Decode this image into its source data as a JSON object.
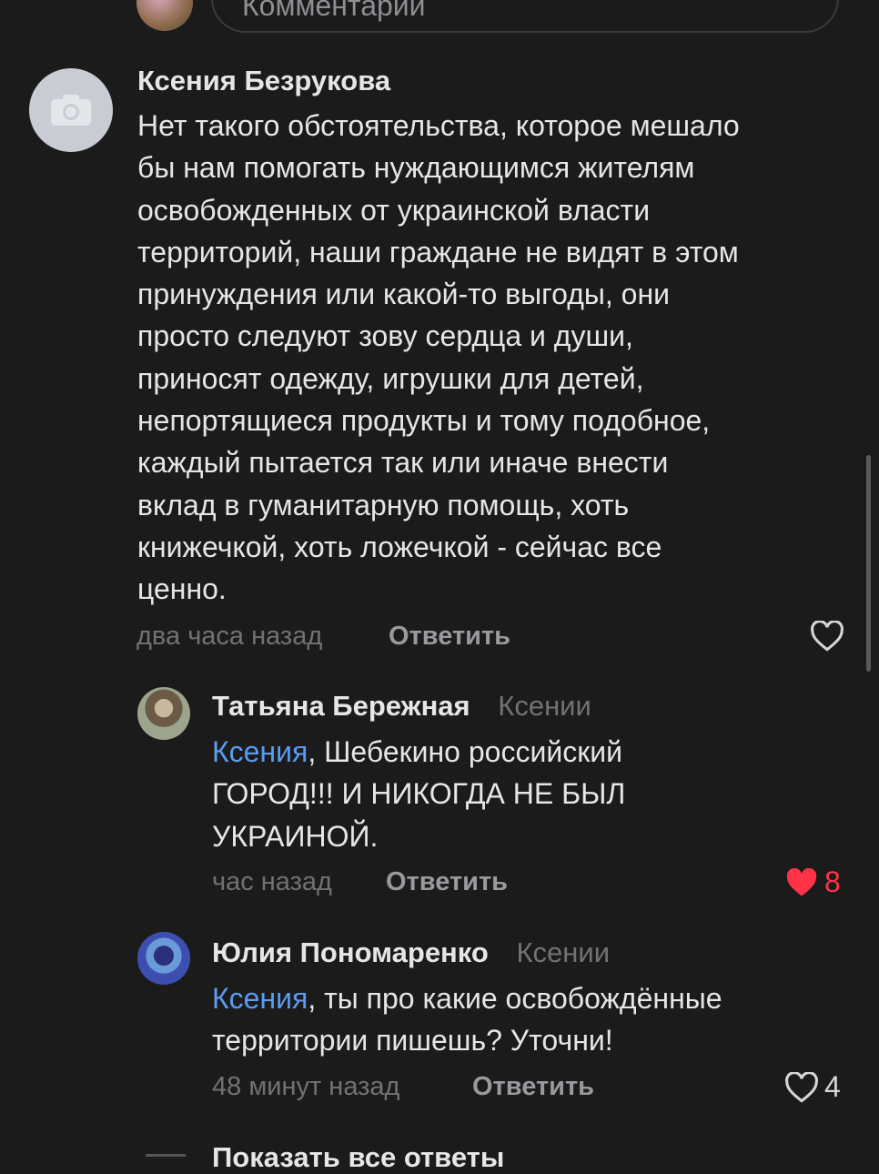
{
  "input": {
    "placeholder": "Комментарий"
  },
  "comment": {
    "author": "Ксения Безрукова",
    "text": "Нет такого обстоятельства, которое мешало бы нам помогать нуждающимся жителям освобожденных от украинской власти территорий, наши граждане не видят в этом принуждения или какой-то выгоды, они просто следуют зову сердца и души, приносят одежду, игрушки для детей, непортящиеся продукты и тому подобное, каждый пытается так или иначе внести вклад в гуманитарную помощь, хоть книжечкой, хоть ложечкой - сейчас все ценно.",
    "lines": [
      "Нет такого обстоятельства, которое мешало",
      "бы нам помогать нуждающимся жителям",
      "освобожденных от украинской власти",
      "территорий, наши граждане не видят в этом",
      "принуждения или какой-то выгоды, они",
      "просто следуют зову сердца и души,",
      "приносят одежду, игрушки для детей,",
      "непортящиеся продукты и тому подобное,",
      "каждый пытается так или иначе внести",
      "вклад в гуманитарную помощь, хоть",
      "книжечкой, хоть ложечкой - сейчас все",
      "ценно."
    ],
    "time": "два часа назад",
    "reply_label": "Ответить",
    "avatar_icon": "camera-icon"
  },
  "replies": [
    {
      "author": "Татьяна Бережная",
      "to": "Ксении",
      "mention": "Ксения",
      "lines": [
        "Ксения, Шебекино российский",
        "ГОРОД!!! И НИКОГДА НЕ БЫЛ",
        "УКРАИНОЙ."
      ],
      "line1_rest": ", Шебекино российский",
      "line2": "ГОРОД!!! И НИКОГДА НЕ БЫЛ",
      "line3": "УКРАИНОЙ.",
      "time": "час назад",
      "reply_label": "Ответить",
      "likes": "8",
      "liked": true,
      "like_color": "#ff3347"
    },
    {
      "author": "Юлия Пономаренко",
      "to": "Ксении",
      "mention": "Ксения",
      "line1_rest": ", ты про какие освобождённые",
      "line2": "территории пишешь? Уточни!",
      "time": "48 минут назад",
      "reply_label": "Ответить",
      "likes": "4",
      "liked": false
    }
  ],
  "show_all": "Показать все ответы",
  "colors": {
    "background": "#1b1b1c",
    "mention": "#5b9bf0",
    "liked_heart": "#ff3347"
  }
}
